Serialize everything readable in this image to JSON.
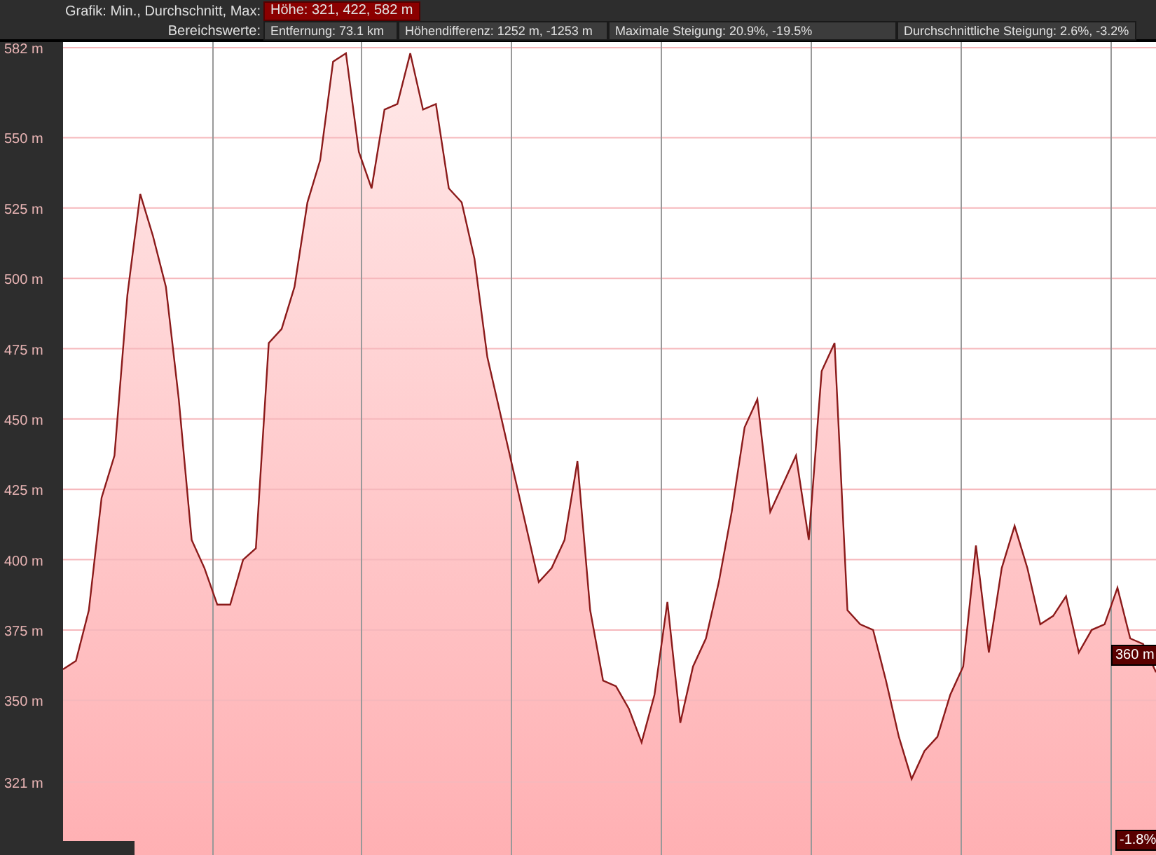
{
  "header": {
    "graph_label": "Grafik: Min., Durchschnitt, Max:",
    "graph_value": "Höhe: 321, 422, 582 m",
    "range_label": "Bereichswerte:",
    "range_values": [
      "Entfernung: 73.1 km",
      "Höhendifferenz: 1252 m, -1253 m",
      "Maximale Steigung: 20.9%, -19.5%",
      "Durchschnittliche Steigung: 2.6%, -3.2%"
    ]
  },
  "chart": {
    "chart_data": {
      "type": "area",
      "grid": true,
      "ylim": [
        295,
        584
      ],
      "yticks": [
        {
          "value": 582,
          "label": "582 m"
        },
        {
          "value": 550,
          "label": "550 m"
        },
        {
          "value": 525,
          "label": "525 m"
        },
        {
          "value": 500,
          "label": "500 m"
        },
        {
          "value": 475,
          "label": "475 m"
        },
        {
          "value": 450,
          "label": "450 m"
        },
        {
          "value": 425,
          "label": "425 m"
        },
        {
          "value": 400,
          "label": "400 m"
        },
        {
          "value": 375,
          "label": "375 m"
        },
        {
          "value": 350,
          "label": "350 m"
        },
        {
          "value": 321,
          "label": "321 m"
        }
      ],
      "series": [
        {
          "color": "#8b1a1a",
          "values": [
            361,
            364,
            382,
            422,
            437,
            494,
            530,
            515,
            497,
            457,
            407,
            397,
            384,
            384,
            400,
            404,
            477,
            482,
            497,
            527,
            542,
            577,
            580,
            545,
            532,
            560,
            562,
            580,
            560,
            562,
            532,
            527,
            507,
            472,
            452,
            432,
            412,
            392,
            397,
            407,
            435,
            382,
            357,
            355,
            347,
            335,
            352,
            385,
            342,
            362,
            372,
            392,
            417,
            447,
            457,
            417,
            427,
            437,
            407,
            467,
            477,
            382,
            377,
            375,
            357,
            337,
            322,
            332,
            337,
            352,
            362,
            405,
            367,
            397,
            412,
            397,
            377,
            380,
            387,
            367,
            375,
            377,
            390,
            372,
            370,
            360
          ]
        }
      ]
    },
    "current_value": "360 m",
    "current_grade": "-1.8%"
  }
}
